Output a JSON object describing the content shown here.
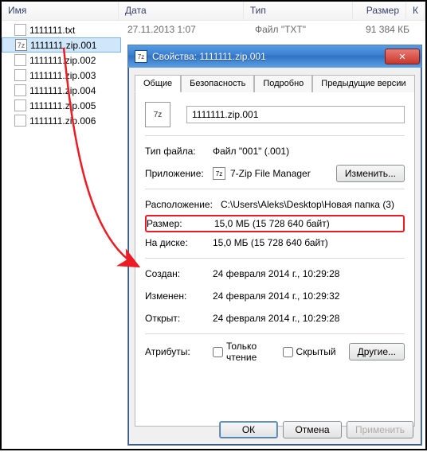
{
  "columns": {
    "name": "Имя",
    "date": "Дата",
    "type": "Тип",
    "size": "Размер",
    "k": "К"
  },
  "top_row": {
    "date": "27.11.2013 1:07",
    "type": "Файл \"TXT\"",
    "size": "91 384 КБ"
  },
  "files": [
    {
      "name": "1111111.txt",
      "sel": false,
      "icon": "txt"
    },
    {
      "name": "1111111.zip.001",
      "sel": true,
      "icon": "7z"
    },
    {
      "name": "1111111.zip.002",
      "sel": false,
      "icon": "blank"
    },
    {
      "name": "1111111.zip.003",
      "sel": false,
      "icon": "blank"
    },
    {
      "name": "1111111.zip.004",
      "sel": false,
      "icon": "blank"
    },
    {
      "name": "1111111.zip.005",
      "sel": false,
      "icon": "blank"
    },
    {
      "name": "1111111.zip.006",
      "sel": false,
      "icon": "blank"
    }
  ],
  "dialog": {
    "title": "Свойства: 1111111.zip.001",
    "tabs": [
      "Общие",
      "Безопасность",
      "Подробно",
      "Предыдущие версии"
    ],
    "filename": "1111111.zip.001",
    "filetype_lbl": "Тип файла:",
    "filetype_val": "Файл \"001\" (.001)",
    "app_lbl": "Приложение:",
    "app_val": "7-Zip File Manager",
    "change_btn": "Изменить...",
    "loc_lbl": "Расположение:",
    "loc_val": "C:\\Users\\Aleks\\Desktop\\Новая папка (3)",
    "size_lbl": "Размер:",
    "size_val": "15,0 МБ (15 728 640 байт)",
    "disk_lbl": "На диске:",
    "disk_val": "15,0 МБ (15 728 640 байт)",
    "created_lbl": "Создан:",
    "created_val": "24 февраля 2014 г., 10:29:28",
    "modified_lbl": "Изменен:",
    "modified_val": "24 февраля 2014 г., 10:29:32",
    "opened_lbl": "Открыт:",
    "opened_val": "24 февраля 2014 г., 10:29:28",
    "attr_lbl": "Атрибуты:",
    "readonly_lbl": "Только чтение",
    "hidden_lbl": "Скрытый",
    "other_btn": "Другие...",
    "ok": "ОК",
    "cancel": "Отмена",
    "apply": "Применить",
    "icon7z": "7z"
  }
}
